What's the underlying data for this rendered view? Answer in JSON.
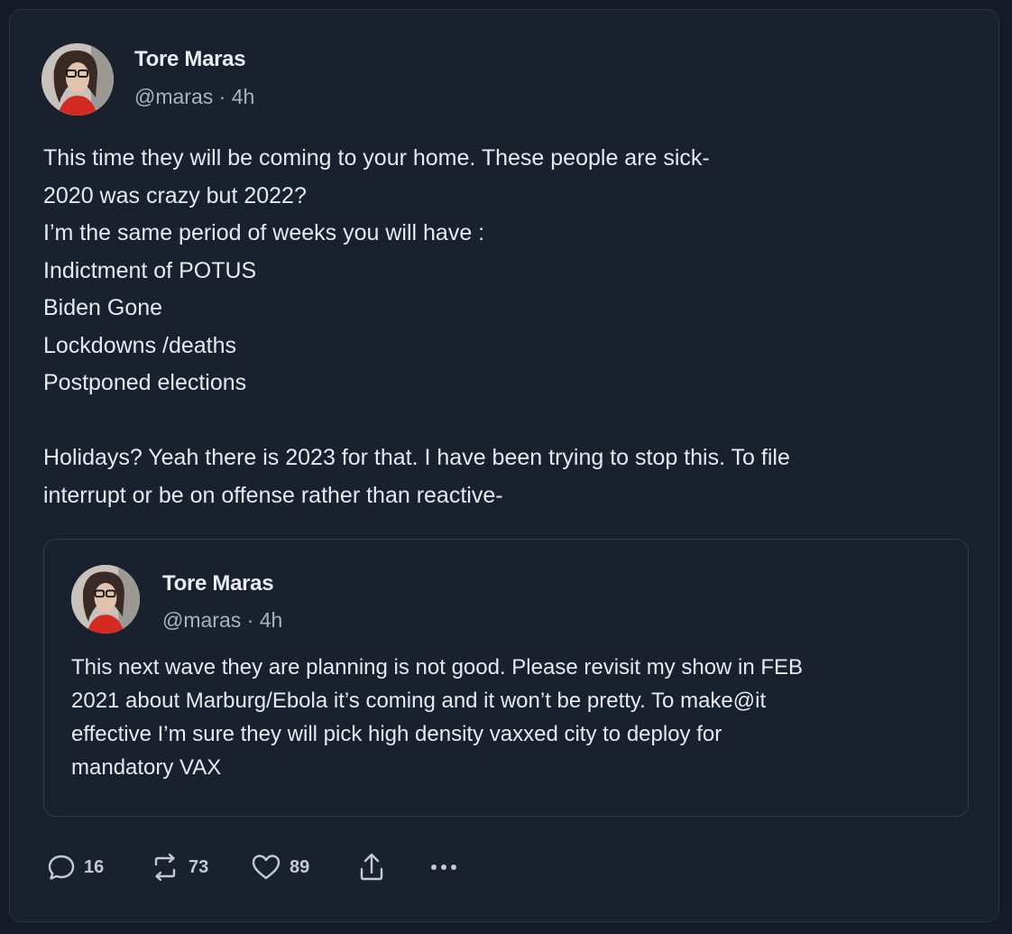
{
  "post": {
    "author_name": "Tore Maras",
    "handle": "@maras · 4h",
    "body_lines": [
      "This time they will be coming to your home. These people are sick-",
      "2020 was crazy but 2022?",
      "I’m the same period of weeks you will have :",
      "Indictment of POTUS",
      "Biden Gone",
      "Lockdowns /deaths",
      "Postponed elections",
      "",
      "Holidays? Yeah there is 2023  for that.  I have been trying to stop this. To file",
      "interrupt or be on offense rather than reactive-"
    ]
  },
  "quoted_post": {
    "author_name": "Tore Maras",
    "handle": "@maras · 4h",
    "body_lines": [
      "This next wave they are planning is not good. Please revisit my show in FEB",
      "2021 about Marburg/Ebola it’s coming and it won’t be pretty. To make@it",
      "effective I’m sure they will pick high density vaxxed city to deploy for",
      "mandatory VAX"
    ]
  },
  "actions": {
    "reply": {
      "icon": "reply-icon",
      "count": "16"
    },
    "repost": {
      "icon": "repost-icon",
      "count": "73"
    },
    "like": {
      "icon": "heart-icon",
      "count": "89"
    },
    "share": {
      "icon": "share-icon"
    },
    "more": {
      "icon": "more-icon"
    }
  },
  "colors": {
    "background": "#141a26",
    "card": "#19202e",
    "border": "#2c3444",
    "text": "#e6e9ee",
    "muted": "#aab2c0"
  }
}
